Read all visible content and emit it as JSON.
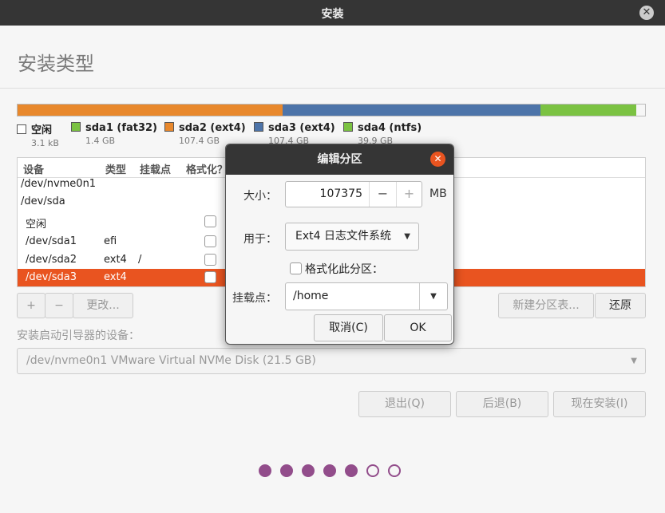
{
  "window": {
    "title": "安装",
    "close_icon": "✕"
  },
  "page": {
    "heading": "安装类型"
  },
  "diskbar": {
    "segments": [
      {
        "name": "sda1",
        "color": "#e8882c",
        "fraction": 0.0118
      },
      {
        "name": "sda2",
        "color": "#e8882c",
        "fraction": 0.4107
      },
      {
        "name": "sda3",
        "color": "#4d74a9",
        "fraction": 0.4107
      },
      {
        "name": "sda4",
        "color": "#7bc242",
        "fraction": 0.1526
      }
    ]
  },
  "legend": [
    {
      "name": "空闲",
      "size": "3.1 kB",
      "color": "#ffffff"
    },
    {
      "name": "sda1 (fat32)",
      "size": "1.4 GB",
      "color": "#7bc242"
    },
    {
      "name": "sda2 (ext4)",
      "size": "107.4 GB",
      "color": "#e8882c"
    },
    {
      "name": "sda3 (ext4)",
      "size": "107.4 GB",
      "color": "#4d74a9"
    },
    {
      "name": "sda4 (ntfs)",
      "size": "39.9 GB",
      "color": "#7bc242"
    }
  ],
  "table": {
    "headers": {
      "device": "设备",
      "type": "类型",
      "mount": "挂载点",
      "format": "格式化？"
    },
    "rows": [
      {
        "device": "/dev/nvme0n1",
        "type": "",
        "mount": ""
      },
      {
        "device": "/dev/sda",
        "type": "",
        "mount": ""
      },
      {
        "device": "空闲",
        "type": "",
        "mount": ""
      },
      {
        "device": "/dev/sda1",
        "type": "efi",
        "mount": ""
      },
      {
        "device": "/dev/sda2",
        "type": "ext4",
        "mount": "/"
      },
      {
        "device": "/dev/sda3",
        "type": "ext4",
        "mount": ""
      }
    ]
  },
  "toolbar": {
    "add": "+",
    "remove": "−",
    "change": "更改...",
    "new_table": "新建分区表...",
    "revert": "还原"
  },
  "boot": {
    "label": "安装启动引导器的设备：",
    "value": "/dev/nvme0n1 VMware Virtual NVMe Disk (21.5 GB)"
  },
  "nav": {
    "quit": "退出(Q)",
    "back": "后退(B)",
    "install": "现在安装(I)"
  },
  "progress": {
    "total_steps": 7,
    "completed_steps": 5,
    "accent": "#924d8b"
  },
  "dialog": {
    "title": "编辑分区",
    "size_label": "大小：",
    "size_value": "107375",
    "size_unit": "MB",
    "minus": "−",
    "plus": "+",
    "use_label": "用于：",
    "use_value": "Ext4 日志文件系统",
    "format_label": "格式化此分区：",
    "format_checked": false,
    "mount_label": "挂载点：",
    "mount_value": "/home",
    "cancel": "取消(C)",
    "ok": "OK"
  }
}
